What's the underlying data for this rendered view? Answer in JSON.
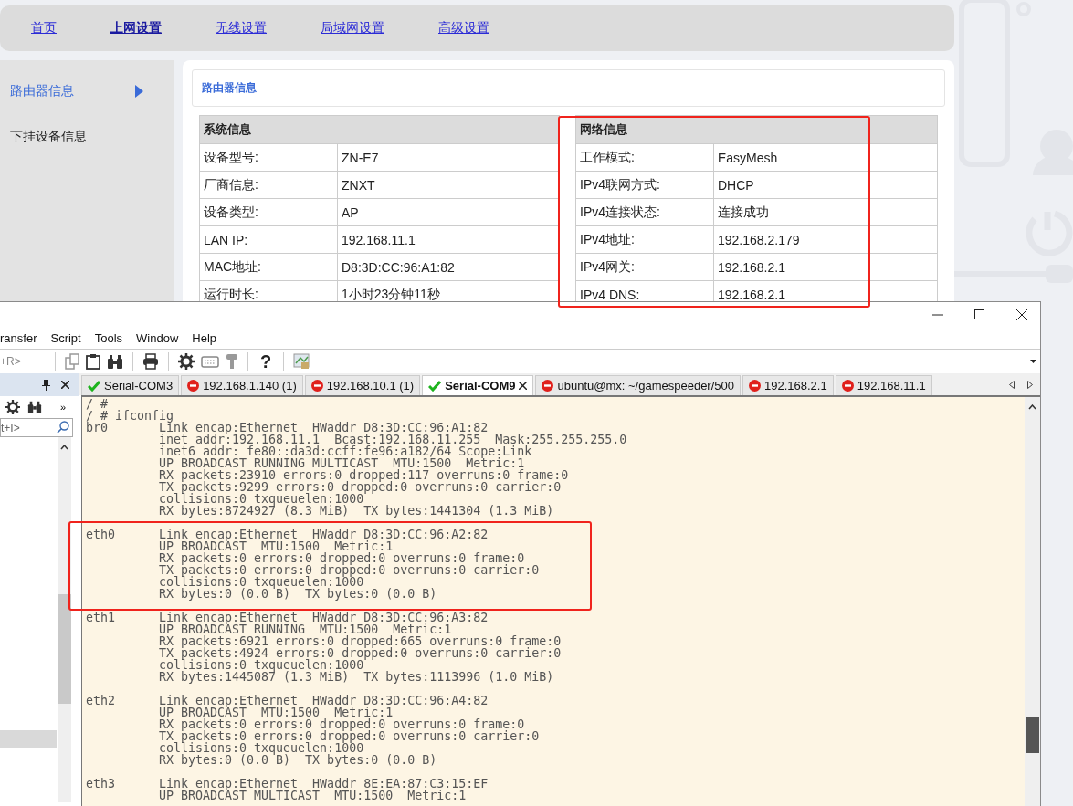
{
  "nav": [
    {
      "label": "首页",
      "selected": false
    },
    {
      "label": "上网设置",
      "selected": true
    },
    {
      "label": "无线设置",
      "selected": false
    },
    {
      "label": "局域网设置",
      "selected": false
    },
    {
      "label": "高级设置",
      "selected": false
    }
  ],
  "sidebar": {
    "items": [
      {
        "label": "路由器信息",
        "selected": true
      },
      {
        "label": "下挂设备信息",
        "selected": false
      }
    ]
  },
  "panel_title": "路由器信息",
  "tables": [
    {
      "title": "系统信息",
      "rows": [
        [
          "设备型号:",
          "ZN-E7"
        ],
        [
          "厂商信息:",
          "ZNXT"
        ],
        [
          "设备类型:",
          "AP"
        ],
        [
          "LAN IP:",
          "192.168.11.1"
        ],
        [
          "MAC地址:",
          "D8:3D:CC:96:A1:82"
        ],
        [
          "运行时长:",
          "1小时23分钟11秒"
        ]
      ]
    },
    {
      "title": "网络信息",
      "rows": [
        [
          "工作模式:",
          "EasyMesh"
        ],
        [
          "IPv4联网方式:",
          "DHCP"
        ],
        [
          "IPv4连接状态:",
          "连接成功"
        ],
        [
          "IPv4地址:",
          "192.168.2.179"
        ],
        [
          "IPv4网关:",
          "192.168.2.1"
        ],
        [
          "IPv4 DNS:",
          "192.168.2.1"
        ]
      ]
    }
  ],
  "terminal_window": {
    "menu": [
      "ransfer",
      "Script",
      "Tools",
      "Window",
      "Help"
    ],
    "toolbar": {
      "field_text": "+R>",
      "help_label": "?"
    },
    "session_pane": {
      "filter_placeholder": "t+I>",
      "more_label": "»"
    },
    "tabs": [
      {
        "label": "Serial-COM3",
        "kind": "connected",
        "selected": false
      },
      {
        "label": "192.168.1.140 (1)",
        "kind": "disconnected",
        "selected": false
      },
      {
        "label": "192.168.10.1 (1)",
        "kind": "disconnected",
        "selected": false
      },
      {
        "label": "Serial-COM9",
        "kind": "connected",
        "selected": true
      },
      {
        "label": "ubuntu@mx: ~/gamespeeder/500",
        "kind": "disconnected",
        "selected": false
      },
      {
        "label": "192.168.2.1",
        "kind": "disconnected",
        "selected": false
      },
      {
        "label": "192.168.11.1",
        "kind": "disconnected",
        "selected": false
      }
    ],
    "prompt_lines": [
      "/ #",
      "/ # ifconfig"
    ],
    "interfaces": [
      {
        "name": "br0",
        "lines": [
          "Link encap:Ethernet  HWaddr D8:3D:CC:96:A1:82",
          "inet addr:192.168.11.1  Bcast:192.168.11.255  Mask:255.255.255.0",
          "inet6 addr: fe80::da3d:ccff:fe96:a182/64 Scope:Link",
          "UP BROADCAST RUNNING MULTICAST  MTU:1500  Metric:1",
          "RX packets:23910 errors:0 dropped:117 overruns:0 frame:0",
          "TX packets:9299 errors:0 dropped:0 overruns:0 carrier:0",
          "collisions:0 txqueuelen:1000",
          "RX bytes:8724927 (8.3 MiB)  TX bytes:1441304 (1.3 MiB)"
        ]
      },
      {
        "name": "eth0",
        "lines": [
          "Link encap:Ethernet  HWaddr D8:3D:CC:96:A2:82",
          "UP BROADCAST  MTU:1500  Metric:1",
          "RX packets:0 errors:0 dropped:0 overruns:0 frame:0",
          "TX packets:0 errors:0 dropped:0 overruns:0 carrier:0",
          "collisions:0 txqueuelen:1000",
          "RX bytes:0 (0.0 B)  TX bytes:0 (0.0 B)"
        ]
      },
      {
        "name": "eth1",
        "lines": [
          "Link encap:Ethernet  HWaddr D8:3D:CC:96:A3:82",
          "UP BROADCAST RUNNING  MTU:1500  Metric:1",
          "RX packets:6921 errors:0 dropped:665 overruns:0 frame:0",
          "TX packets:4924 errors:0 dropped:0 overruns:0 carrier:0",
          "collisions:0 txqueuelen:1000",
          "RX bytes:1445087 (1.3 MiB)  TX bytes:1113996 (1.0 MiB)"
        ]
      },
      {
        "name": "eth2",
        "lines": [
          "Link encap:Ethernet  HWaddr D8:3D:CC:96:A4:82",
          "UP BROADCAST  MTU:1500  Metric:1",
          "RX packets:0 errors:0 dropped:0 overruns:0 frame:0",
          "TX packets:0 errors:0 dropped:0 overruns:0 carrier:0",
          "collisions:0 txqueuelen:1000",
          "RX bytes:0 (0.0 B)  TX bytes:0 (0.0 B)"
        ]
      },
      {
        "name": "eth3",
        "lines": [
          "Link encap:Ethernet  HWaddr 8E:EA:87:C3:15:EF",
          "UP BROADCAST MULTICAST  MTU:1500  Metric:1"
        ]
      }
    ]
  }
}
